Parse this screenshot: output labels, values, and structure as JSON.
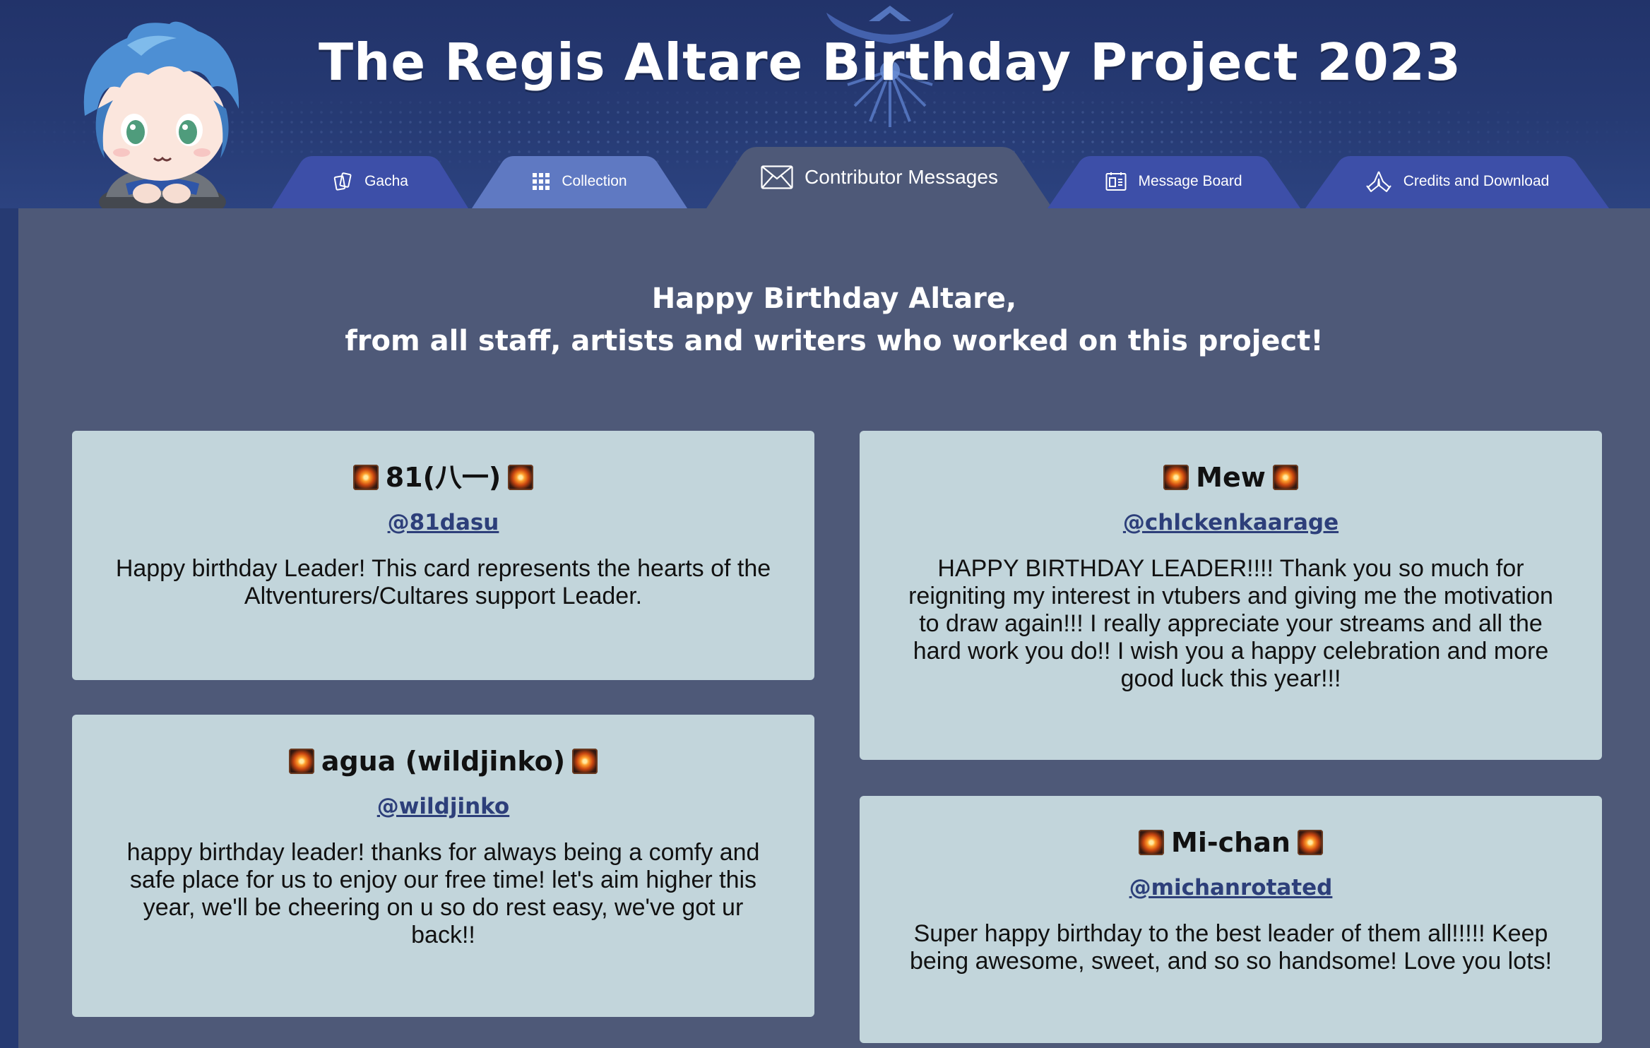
{
  "header": {
    "title": "The Regis Altare Birthday Project 2023"
  },
  "nav": {
    "tabs": [
      {
        "label": "Gacha",
        "icon": "cards-icon"
      },
      {
        "label": "Collection",
        "icon": "grid-icon"
      },
      {
        "label": "Contributor Messages",
        "icon": "envelope-icon",
        "active": true
      },
      {
        "label": "Message Board",
        "icon": "board-icon"
      },
      {
        "label": "Credits and Download",
        "icon": "praying-hands-icon"
      }
    ],
    "colors": {
      "tab": "#3d4fa8",
      "tab_light": "#5f79c2",
      "active_tab": "#4e5978"
    }
  },
  "intro": {
    "line1": "Happy Birthday Altare,",
    "line2": "from all staff, artists and writers who worked on this project!"
  },
  "messages": [
    {
      "name": "81(八一)",
      "handle": "@81dasu",
      "text": "Happy birthday Leader! This card represents the hearts of the Altventurers/Cultares support Leader."
    },
    {
      "name": "Mew",
      "handle": "@chlckenkaarage",
      "text": "HAPPY BIRTHDAY LEADER!!!! Thank you so much for reigniting my interest in vtubers and giving me the motivation to draw again!!! I really appreciate your streams and all the hard work you do!! I wish you a happy celebration and more good luck this year!!!"
    },
    {
      "name": "agua (wildjinko)",
      "handle": "@wildjinko",
      "text": "happy birthday leader! thanks for always being a comfy and safe place for us to enjoy our free time! let's aim higher this year, we'll be cheering on u so do rest easy, we've got ur back!!"
    },
    {
      "name": "Mi-chan",
      "handle": "@michanrotated",
      "text": "Super happy birthday to the best leader of them all!!!!! Keep being awesome, sweet, and so so handsome! Love you lots!"
    }
  ],
  "theme": {
    "background": "#263a72",
    "panel": "#4e5978",
    "card": "#c2d5db",
    "link": "#2d3f7a"
  }
}
